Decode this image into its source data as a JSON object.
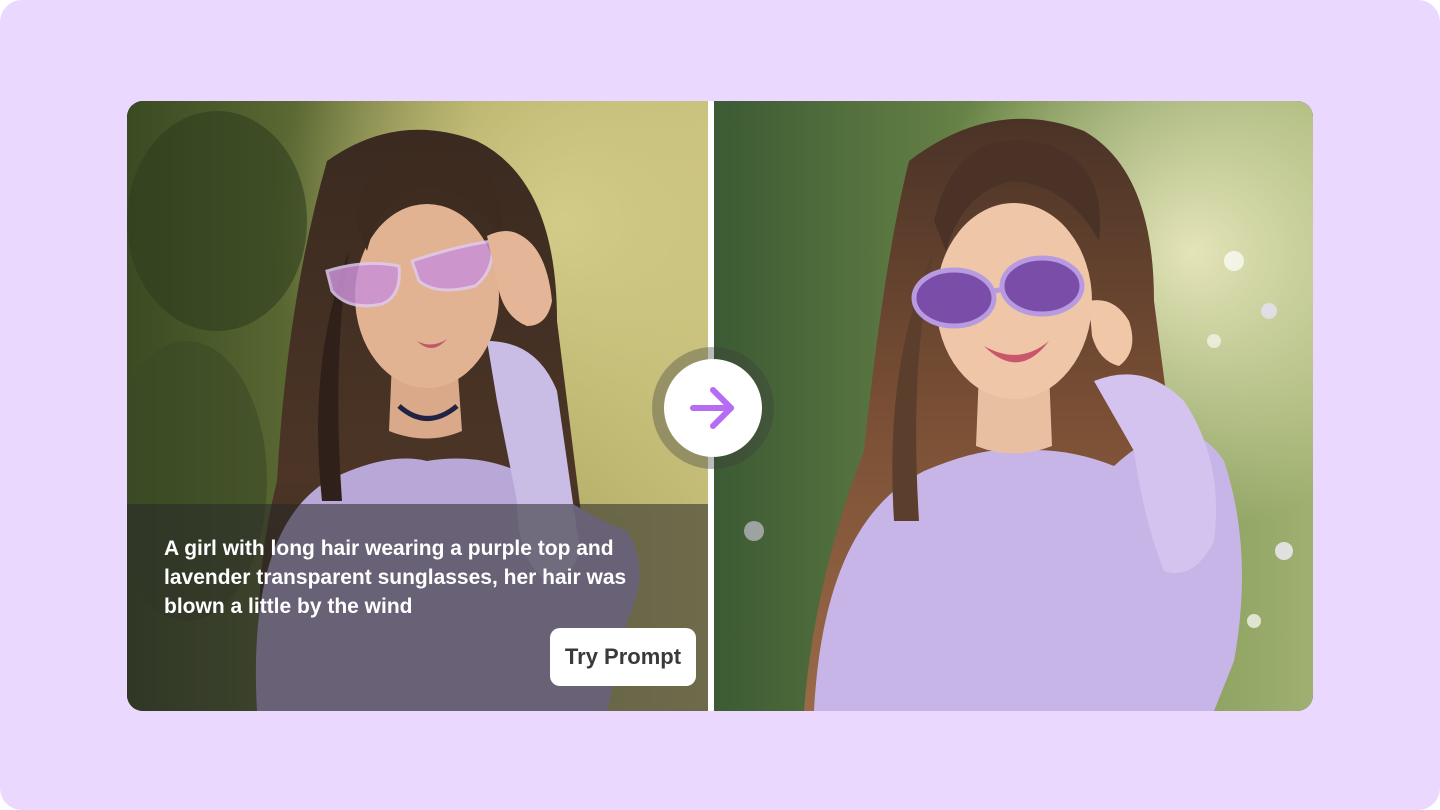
{
  "colors": {
    "page_background": "#ead8fe",
    "accent": "#b66cf2",
    "button_text": "#3a3a3a"
  },
  "comparison": {
    "prompt_text": "A girl with long hair wearing a purple top and lavender transparent sunglasses, her hair was blown a little by the wind",
    "try_button_label": "Try Prompt",
    "arrow_icon": "arrow-right-icon"
  }
}
